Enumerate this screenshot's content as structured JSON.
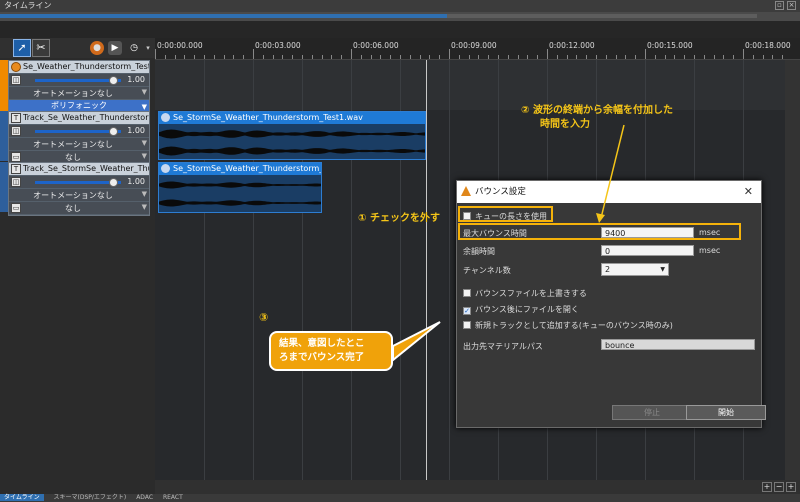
{
  "app": {
    "window_title": "タイムライン"
  },
  "ruler": {
    "ticks": [
      "0:00:00.000",
      "0:00:03.000",
      "0:00:06.000",
      "0:00:09.000",
      "0:00:12.000",
      "0:00:15.000",
      "0:00:18.000"
    ]
  },
  "tracks": [
    {
      "name": "Se_Weather_Thunderstorm_Test",
      "volume": "1.00",
      "automation": "オートメーションなし",
      "mode": "ポリフォニック"
    },
    {
      "name": "Track_Se_Weather_Thunderstorm_Test",
      "volume": "1.00",
      "automation": "オートメーションなし",
      "mode": "なし"
    },
    {
      "name": "Track_Se_StormSe_Weather_Thunderstorm",
      "volume": "1.00",
      "automation": "オートメーションなし",
      "mode": "なし"
    }
  ],
  "clips": [
    {
      "label": "Se_StormSe_Weather_Thunderstorm_Test1.wav"
    },
    {
      "label": "Se_StormSe_Weather_Thunderstorm_Test"
    }
  ],
  "dialog": {
    "title": "バウンス設定",
    "use_cue_length_label": "キューの長さを使用",
    "use_cue_length_checked": false,
    "max_bounce_label": "最大バウンス時間",
    "max_bounce_value": "9400",
    "max_bounce_unit": "msec",
    "margin_label": "余韻時間",
    "margin_value": "0",
    "margin_unit": "msec",
    "channels_label": "チャンネル数",
    "channels_value": "2",
    "overwrite_label": "バウンスファイルを上書きする",
    "overwrite_checked": false,
    "open_after_label": "バウンス後にファイルを開く",
    "open_after_checked": true,
    "add_track_label": "新規トラックとして追加する(キューのバウンス時のみ)",
    "add_track_checked": false,
    "output_label": "出力先マテリアルパス",
    "output_value": "bounce",
    "stop_button": "停止",
    "start_button": "開始"
  },
  "annotations": {
    "step1": "① チェックを外す",
    "step2_line1": "② 波形の終端から余幅を付加した",
    "step2_line2": "時間を入力",
    "step3": "③",
    "callout_line1": "結果、意図したとこ",
    "callout_line2": "ろまでバウンス完了"
  },
  "status_tabs": [
    "タイムライン",
    "スキーマ(DSP/エフェクト)",
    "ADAC",
    "REACT"
  ]
}
